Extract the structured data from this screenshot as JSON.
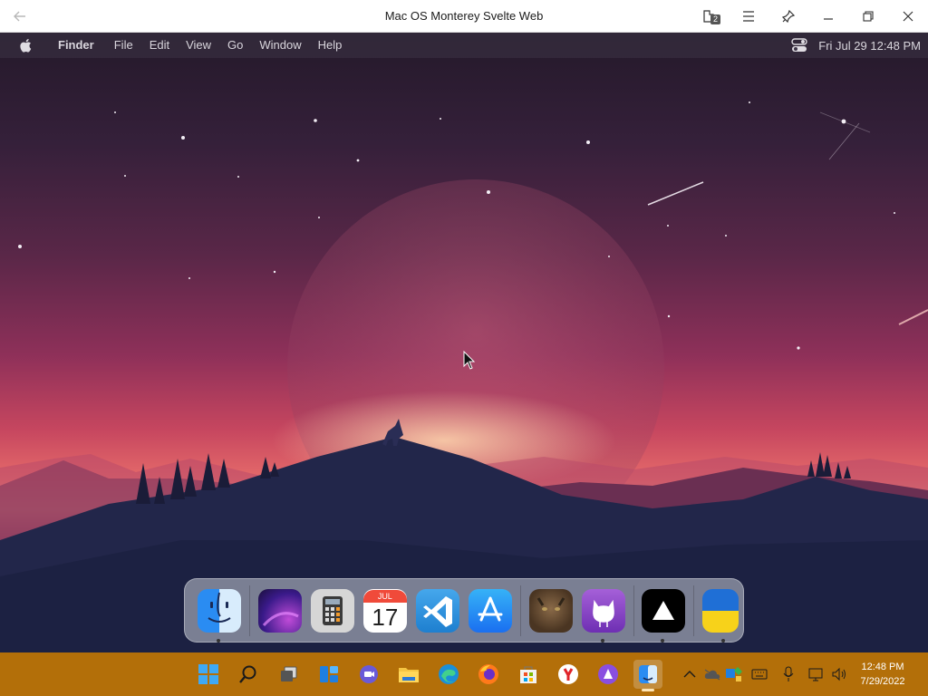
{
  "window": {
    "title": "Mac OS Monterey Svelte Web",
    "extensions_badge": "2",
    "back_icon": "back-arrow-icon",
    "actions": [
      "extensions-icon",
      "menu-icon",
      "pin-icon",
      "minimize-icon",
      "restore-icon",
      "close-icon"
    ]
  },
  "menubar": {
    "app_name": "Finder",
    "items": [
      "File",
      "Edit",
      "View",
      "Go",
      "Window",
      "Help"
    ],
    "clock": "Fri Jul 29  12:48 PM",
    "icons": [
      "apple-logo-icon",
      "control-center-icon"
    ]
  },
  "dock": {
    "calendar_month": "JUL",
    "calendar_day": "17",
    "items": [
      {
        "name": "finder",
        "running": true
      },
      {
        "name": "wallpapers",
        "running": false
      },
      {
        "name": "calculator",
        "running": false
      },
      {
        "name": "calendar",
        "running": false
      },
      {
        "name": "vscode",
        "running": false
      },
      {
        "name": "app-store",
        "running": false
      },
      {
        "name": "cat-photo",
        "running": false
      },
      {
        "name": "github",
        "running": true
      },
      {
        "name": "vercel",
        "running": true
      },
      {
        "name": "ukraine-flag",
        "running": true
      }
    ]
  },
  "taskbar": {
    "time": "12:48 PM",
    "date": "7/29/2022",
    "apps": [
      "start",
      "search",
      "task-view",
      "widgets",
      "teams-chat",
      "file-explorer",
      "edge",
      "firefox",
      "microsoft-store",
      "yandex",
      "alice",
      "finder-pwa"
    ],
    "tray": [
      "show-hidden-icons",
      "onedrive",
      "defender",
      "keyboard",
      "microphone",
      "network",
      "volume"
    ]
  },
  "colors": {
    "taskbar": "#b36f09",
    "sky_top": "#24192a",
    "sky_horizon": "#e56a6a",
    "mountain": "#1e2238"
  }
}
